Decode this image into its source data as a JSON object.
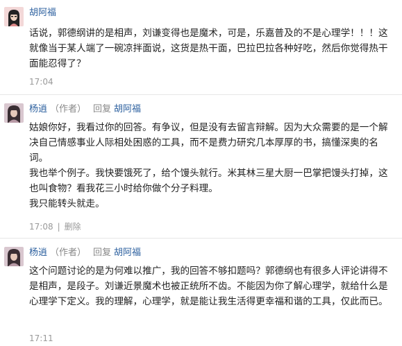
{
  "comments": [
    {
      "author": "胡阿福",
      "paragraphs": [
        "话说，郭德纲讲的是相声，刘谦变得也是魔术，可是，乐嘉普及的不是心理学！！！这就像当于某人端了一碗凉拌面说，这货是热干面，巴拉巴拉各种好吃，然后你觉得热干面能忍得了？"
      ],
      "time": "17:04"
    },
    {
      "author": "杨逍",
      "author_tag": "（作者）",
      "reply_word": "回复",
      "reply_to": "胡阿福",
      "paragraphs": [
        "姑娘你好，我看过你的回答。有争议，但是没有去留言辩解。因为大众需要的是一个解决自己情感事业人际相处困惑的工具，而不是费力研究几本厚厚的书，搞懂深奥的名词。",
        "我也举个例子。我快要饿死了，给个馒头就行。米其林三星大厨一巴掌把馒头打掉，这也叫食物？看我花三小时给你做个分子料理。",
        "我只能转头就走。"
      ],
      "time": "17:08",
      "delete_label": "删除"
    },
    {
      "author": "杨逍",
      "author_tag": "（作者）",
      "reply_word": "回复",
      "reply_to": "胡阿福",
      "paragraphs": [
        "这个问题讨论的是为何难以推广，我的回答不够扣题吗？郭德纲也有很多人评论讲得不是相声，是段子。刘谦近景魔术也被正统所不齿。不能因为你了解心理学，就给什么是心理学下定义。我的理解，心理学，就是能让我生活得更幸福和谐的工具，仅此而已。"
      ],
      "time": "17:11"
    }
  ],
  "colors": {
    "link": "#2b5f9e",
    "meta": "#999999",
    "text": "#222222",
    "divider": "#e6e6e6"
  }
}
